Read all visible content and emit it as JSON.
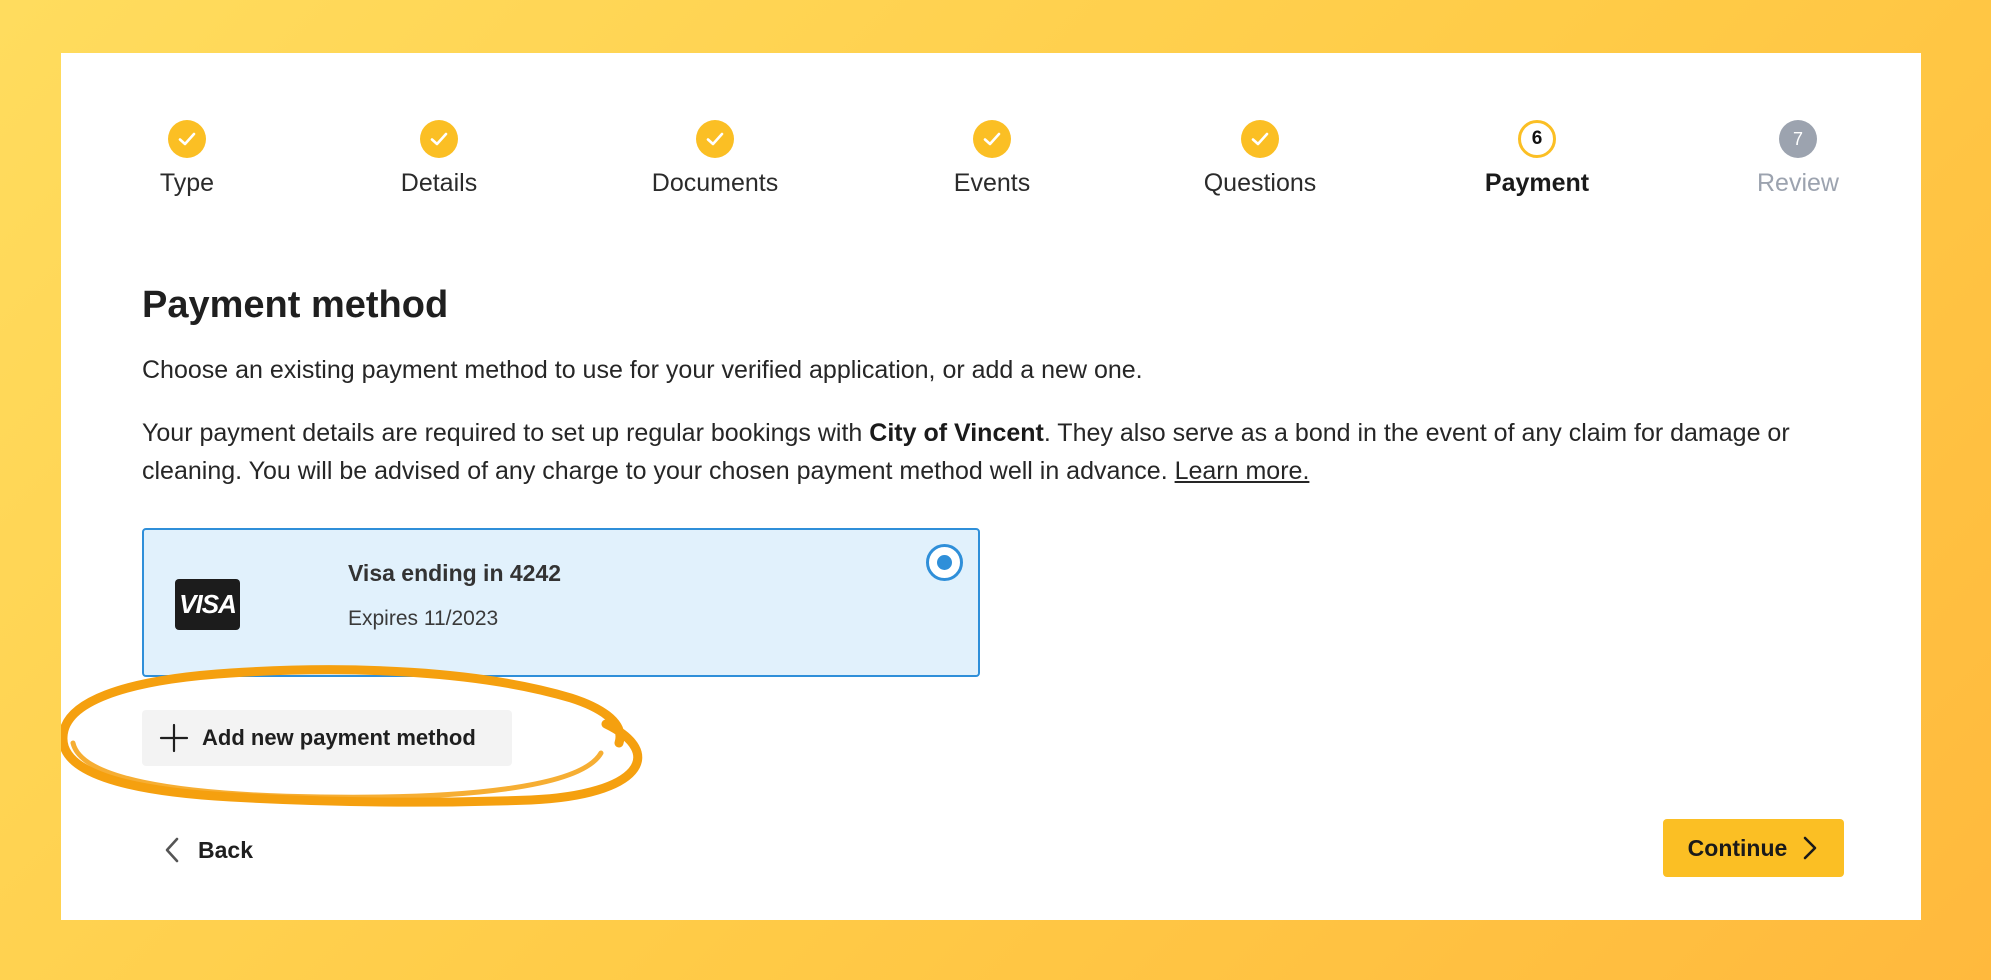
{
  "steps": [
    {
      "label": "Type",
      "status": "done"
    },
    {
      "label": "Details",
      "status": "done"
    },
    {
      "label": "Documents",
      "status": "done"
    },
    {
      "label": "Events",
      "status": "done"
    },
    {
      "label": "Questions",
      "status": "done"
    },
    {
      "label": "Payment",
      "status": "current",
      "number": "6"
    },
    {
      "label": "Review",
      "status": "future",
      "number": "7"
    }
  ],
  "page": {
    "title": "Payment method",
    "intro": "Choose an existing payment method to use for your verified application, or add a new one.",
    "details_pre": "Your payment details are required to set up regular bookings with ",
    "details_org": "City of Vincent",
    "details_post": ". They also serve as a bond in the event of any claim for damage or cleaning. You will be advised of any charge to your chosen payment method well in advance. ",
    "learn_more": "Learn more."
  },
  "payment_method": {
    "brand": "VISA",
    "title": "Visa ending in 4242",
    "expiry": "Expires 11/2023",
    "selected": true
  },
  "actions": {
    "add_label": "Add new payment method",
    "back_label": "Back",
    "continue_label": "Continue"
  },
  "colors": {
    "accent": "#fbbf24",
    "selected_blue": "#2f8fd9",
    "card_bg": "#e1f1fc",
    "annotation": "#f5a00f"
  }
}
